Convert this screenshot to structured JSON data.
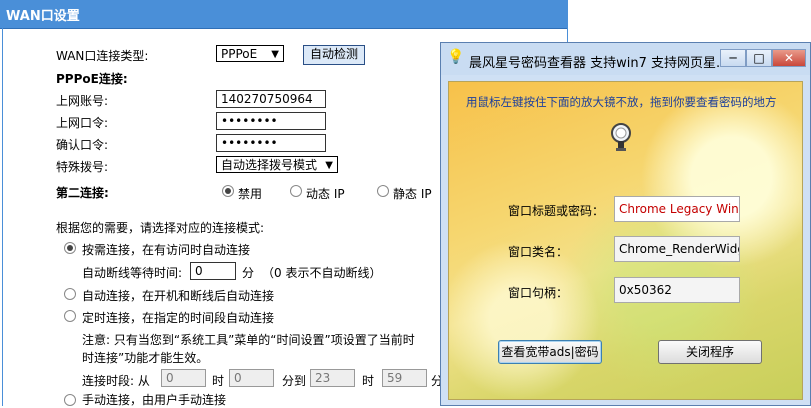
{
  "router": {
    "title": "WAN口设置",
    "conn_type_label": "WAN口连接类型:",
    "conn_type_value": "PPPoE",
    "detect_button": "自动检测",
    "pppoe_heading": "PPPoE连接:",
    "account_label": "上网账号:",
    "account_value": "140270750964",
    "password_label": "上网口令:",
    "password_value": "••••••••",
    "confirm_label": "确认口令:",
    "confirm_value": "••••••••",
    "dial_label": "特殊拨号:",
    "dial_value": "自动选择拨号模式",
    "second_conn_label": "第二连接:",
    "second_opts": [
      "禁用",
      "动态 IP",
      "静态 IP"
    ],
    "mode_intro": "根据您的需要，请选择对应的连接模式:",
    "mode_demand": "按需连接，在有访问时自动连接",
    "idle_label": "自动断线等待时间:",
    "idle_value": "0",
    "idle_unit": "分",
    "idle_note": "（0 表示不自动断线）",
    "mode_auto": "自动连接，在开机和断线后自动连接",
    "mode_timed": "定时连接，在指定的时间段自动连接",
    "note_line1": "注意: 只有当您到“系统工具”菜单的“时间设置”项设置了当前时",
    "note_line2": "时连接”功能才能生效。",
    "period_label": "连接时段: 从",
    "period_from_h": "0",
    "hour1": "时",
    "period_from_m": "0",
    "to_label": "分到",
    "period_to_h": "23",
    "hour2": "时",
    "period_to_m": "59",
    "min_tail": "分",
    "mode_manual": "手动连接，由用户手动连接"
  },
  "popup": {
    "title": "晨风星号密码查看器 支持win7 支持网页星...",
    "minimize": "─",
    "maximize": "□",
    "close": "✕",
    "hint": "用鼠标左键按住下面的放大镜不放，拖到你要查看密码的地方",
    "caption_label": "窗口标题或密码：",
    "caption_value": "Chrome Legacy Wind",
    "class_label": "窗口类名：",
    "class_value": "Chrome_RenderWidg",
    "handle_label": "窗口句柄：",
    "handle_value": "0x50362",
    "view_button": "查看宽带ads|密码",
    "close_button": "关闭程序"
  }
}
